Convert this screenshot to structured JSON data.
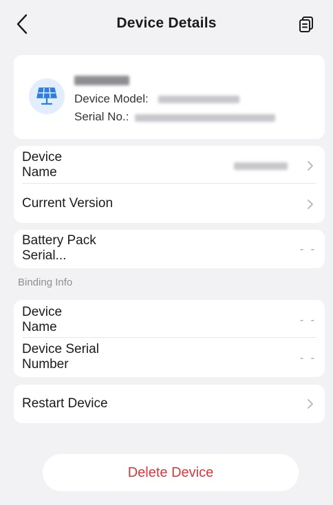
{
  "header": {
    "title": "Device Details",
    "back_icon": "chevron-left-icon",
    "copy_icon": "copy-icon"
  },
  "device": {
    "icon": "solar-panel-icon",
    "model_label": "Device Model:",
    "serial_label": "Serial No.:"
  },
  "rows": {
    "device_name": "Device\nName",
    "current_version": "Current Version",
    "battery_pack_serial": "Battery Pack\nSerial...",
    "battery_pack_serial_value": "- -"
  },
  "binding": {
    "section_title": "Binding Info",
    "device_name": "Device\nName",
    "device_name_value": "- -",
    "device_serial": "Device Serial\nNumber",
    "device_serial_value": "- -"
  },
  "actions": {
    "restart": "Restart Device",
    "delete": "Delete Device"
  },
  "colors": {
    "background": "#f2f2f5",
    "card": "#ffffff",
    "delete_text": "#d9363e",
    "icon_accent": "#2f7fd8"
  }
}
